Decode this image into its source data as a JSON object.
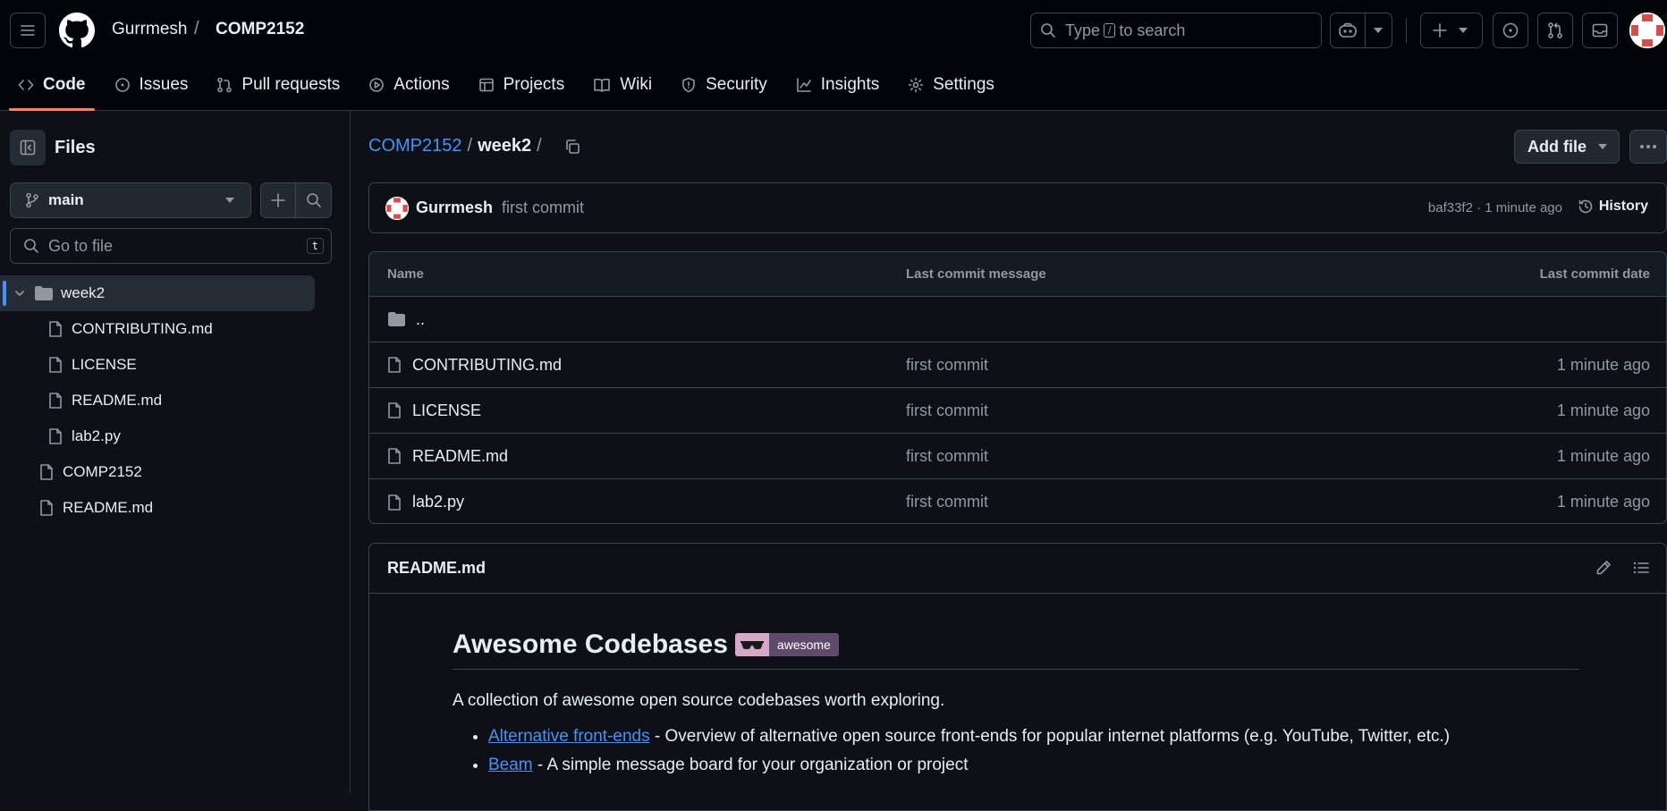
{
  "header": {
    "owner": "Gurrmesh",
    "separator": "/",
    "repo": "COMP2152",
    "search": {
      "prefix": "Type",
      "key": "/",
      "suffix": "to search"
    }
  },
  "tabs": [
    {
      "label": "Code",
      "icon": "code-icon",
      "active": true
    },
    {
      "label": "Issues",
      "icon": "issue-icon"
    },
    {
      "label": "Pull requests",
      "icon": "pull-request-icon"
    },
    {
      "label": "Actions",
      "icon": "play-icon"
    },
    {
      "label": "Projects",
      "icon": "table-icon"
    },
    {
      "label": "Wiki",
      "icon": "book-icon"
    },
    {
      "label": "Security",
      "icon": "shield-icon"
    },
    {
      "label": "Insights",
      "icon": "graph-icon"
    },
    {
      "label": "Settings",
      "icon": "gear-icon"
    }
  ],
  "sidebar": {
    "title": "Files",
    "branch": "main",
    "goto_placeholder": "Go to file",
    "goto_key": "t",
    "tree": [
      {
        "label": "week2",
        "type": "folder",
        "expanded": true,
        "selected": true
      },
      {
        "label": "CONTRIBUTING.md",
        "type": "file"
      },
      {
        "label": "LICENSE",
        "type": "file"
      },
      {
        "label": "README.md",
        "type": "file"
      },
      {
        "label": "lab2.py",
        "type": "file"
      },
      {
        "label": "COMP2152",
        "type": "file"
      },
      {
        "label": "README.md",
        "type": "file"
      }
    ]
  },
  "main": {
    "breadcrumb": {
      "repo": "COMP2152",
      "sep": "/",
      "folder": "week2",
      "trail": "/"
    },
    "add_file": "Add file",
    "commit": {
      "author": "Gurrmesh",
      "message": "first commit",
      "meta": "baf33f2 · 1 minute ago",
      "history": "History"
    },
    "table": {
      "headers": {
        "name": "Name",
        "message": "Last commit message",
        "date": "Last commit date"
      },
      "parent": "..",
      "rows": [
        {
          "name": "CONTRIBUTING.md",
          "message": "first commit",
          "date": "1 minute ago"
        },
        {
          "name": "LICENSE",
          "message": "first commit",
          "date": "1 minute ago"
        },
        {
          "name": "README.md",
          "message": "first commit",
          "date": "1 minute ago"
        },
        {
          "name": "lab2.py",
          "message": "first commit",
          "date": "1 minute ago"
        }
      ]
    },
    "readme": {
      "filename": "README.md",
      "title": "Awesome Codebases",
      "badge": "awesome",
      "intro": "A collection of awesome open source codebases worth exploring.",
      "items": [
        {
          "link": "Alternative front-ends",
          "text": " - Overview of alternative open source front-ends for popular internet platforms (e.g. YouTube, Twitter, etc.)"
        },
        {
          "link": "Beam",
          "text": " - A simple message board for your organization or project"
        }
      ]
    }
  },
  "colors": {
    "accent": "#4493f8",
    "tab_underline": "#f78166",
    "bg": "#0d1117",
    "header_bg": "#010409",
    "border": "#3d444d"
  }
}
